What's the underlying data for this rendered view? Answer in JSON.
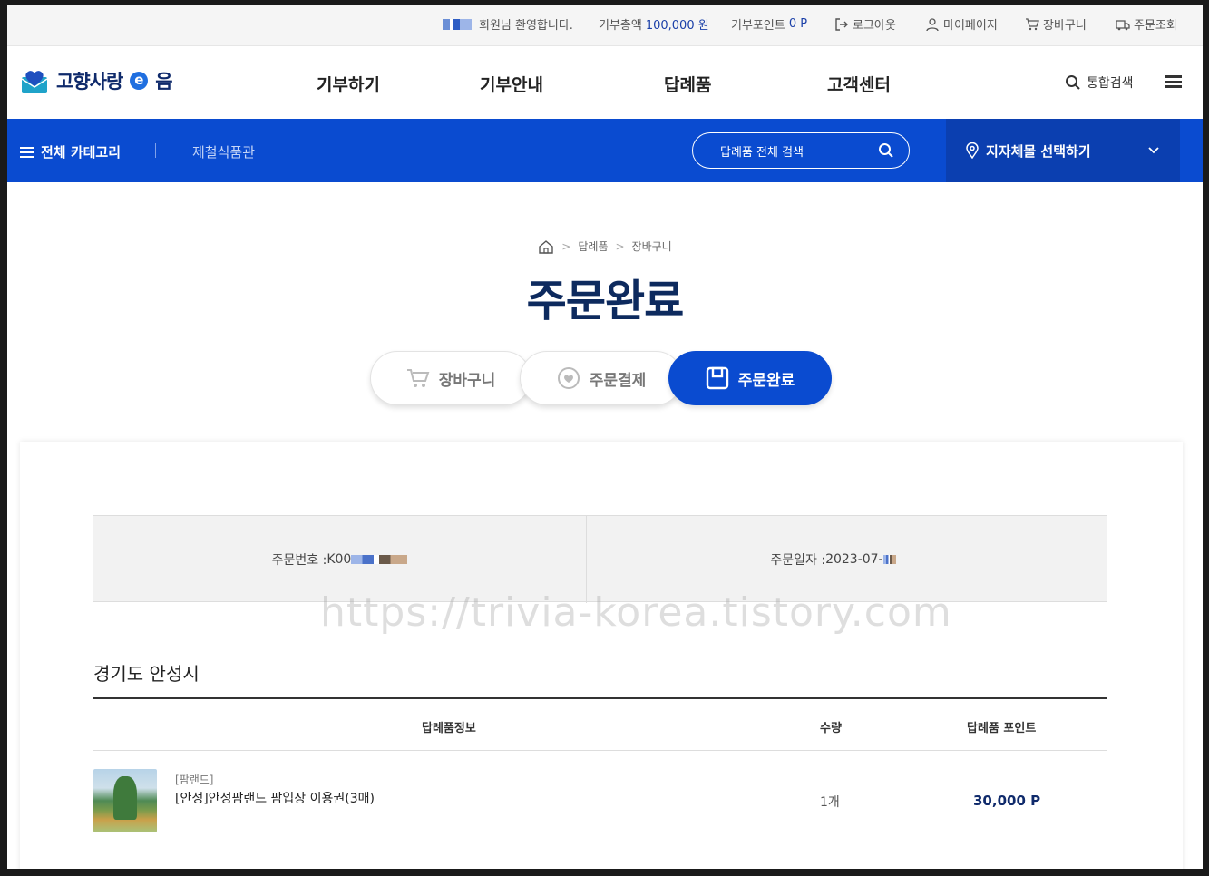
{
  "util": {
    "welcome": "회원님 환영합니다.",
    "donation_label": "기부총액",
    "donation_value": "100,000 원",
    "points_label": "기부포인트",
    "points_value": "0 P",
    "logout": "로그아웃",
    "mypage": "마이페이지",
    "cart": "장바구니",
    "order_lookup": "주문조회"
  },
  "header": {
    "logo_text_1": "고향사랑",
    "logo_e": "e",
    "logo_text_2": "음",
    "nav": [
      "기부하기",
      "기부안내",
      "답례품",
      "고객센터"
    ],
    "search_label": "통합검색"
  },
  "bar": {
    "all_category": "전체 카테고리",
    "sub_menu": "제철식품관",
    "search_placeholder": "답례품 전체 검색",
    "region_select": "지자체몰 선택하기"
  },
  "breadcrumb": [
    "답례품",
    "장바구니"
  ],
  "page_title": "주문완료",
  "steps": [
    {
      "label": "장바구니",
      "icon": "cart-icon",
      "active": false
    },
    {
      "label": "주문결제",
      "icon": "heart-icon",
      "active": false
    },
    {
      "label": "주문완료",
      "icon": "save-icon",
      "active": true
    }
  ],
  "order": {
    "number_label": "주문번호 : ",
    "number_value": "K00",
    "date_label": "주문일자 : ",
    "date_value": "2023-07-"
  },
  "region_title": "경기도 안성시",
  "table": {
    "headers": {
      "info": "답례품정보",
      "qty": "수량",
      "points": "답례품 포인트"
    },
    "rows": [
      {
        "category": "[팜랜드]",
        "name": "[안성]안성팜랜드 팜입장 이용권(3매)",
        "qty": "1개",
        "points": "30,000 P"
      }
    ]
  },
  "watermark": "https://trivia-korea.tistory.com",
  "colors": {
    "primary": "#0a4bd0",
    "navy": "#0d2a5e"
  }
}
